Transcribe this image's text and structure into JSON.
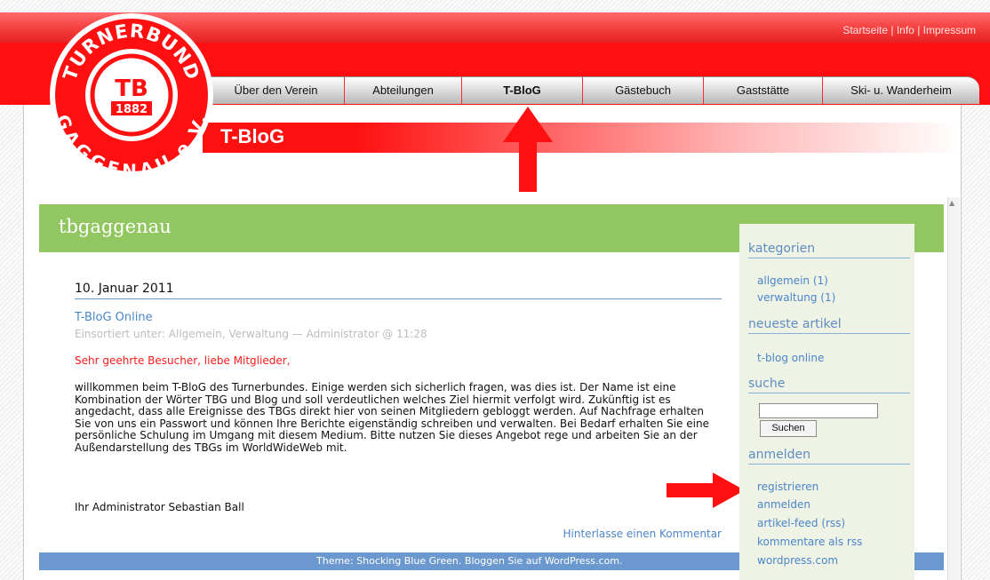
{
  "header": {
    "top_links": [
      "Startseite",
      "Info",
      "Impressum"
    ],
    "logo_text": {
      "top": "TURNERBUND",
      "monogram": "TB",
      "year": "1882",
      "bottom": "GAGGENAU e.V."
    }
  },
  "nav": {
    "items": [
      "Über den Verein",
      "Abteilungen",
      "T-BloG",
      "Gästebuch",
      "Gaststätte",
      "Ski- u. Wanderheim"
    ]
  },
  "page": {
    "subtitle": "T-BloG"
  },
  "blog": {
    "name": "tbgaggenau",
    "post": {
      "date": "10. Januar 2011",
      "title": "T-BloG Online",
      "meta": "Einsortiert unter: Allgemein, Verwaltung — Administrator @ 11:28",
      "greeting": "Sehr geehrte Besucher, liebe Mitglieder,",
      "body": "willkommen beim T-BloG des Turnerbundes. Einige werden sich sicherlich fragen, was dies ist. Der Name ist eine Kombination der Wörter TBG und Blog und soll verdeutlichen welches Ziel hiermit verfolgt wird. Zukünftig ist es angedacht, dass alle Ereignisse des TBGs direkt hier von seinen Mitgliedern gebloggt werden. Auf Nachfrage erhalten Sie von uns ein Passwort und können Ihre Berichte eigenständig schreiben und verwalten. Bei Bedarf erhalten Sie eine persönliche Schulung im Umgang mit diesem Medium. Bitte nutzen Sie dieses Angebot rege und arbeiten Sie an der Außendarstellung des TBGs im WorldWideWeb mit.",
      "signature": "Ihr Administrator Sebastian Ball",
      "comment_link": "Hinterlasse einen Kommentar"
    },
    "footer": "Theme: Shocking Blue Green. Bloggen Sie auf WordPress.com."
  },
  "sidebar": {
    "categories_heading": "kategorien",
    "categories": [
      "allgemein (1)",
      "verwaltung (1)"
    ],
    "recent_heading": "neueste artikel",
    "recent": [
      "t-blog online"
    ],
    "search_heading": "suche",
    "search_value": "",
    "search_button": "Suchen",
    "login_heading": "anmelden",
    "login_links": [
      "registrieren",
      "anmelden",
      "artikel-feed (rss)",
      "kommentare als rss",
      "wordpress.com"
    ]
  },
  "colors": {
    "brand_red": "#ff0f0f",
    "blog_green": "#92c661",
    "link_blue": "#4b86c8",
    "footer_blue": "#6b98cf"
  }
}
